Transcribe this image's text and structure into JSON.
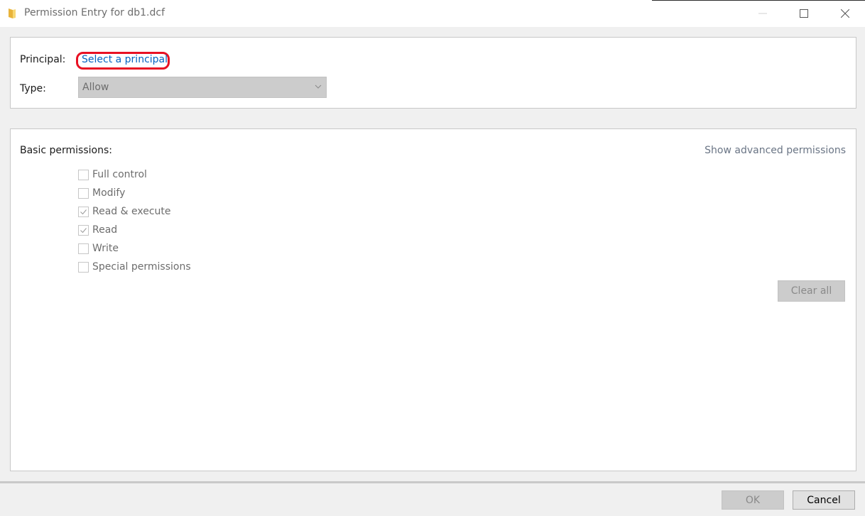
{
  "window": {
    "title": "Permission Entry for db1.dcf",
    "icon": "folder-icon",
    "controls": [
      "minimize",
      "maximize",
      "close"
    ]
  },
  "principal_section": {
    "principal_label": "Principal:",
    "principal_link": "Select a principal",
    "type_label": "Type:",
    "type_value": "Allow"
  },
  "permissions_section": {
    "heading": "Basic permissions:",
    "advanced_link": "Show advanced permissions",
    "items": [
      {
        "label": "Full control",
        "checked": false
      },
      {
        "label": "Modify",
        "checked": false
      },
      {
        "label": "Read & execute",
        "checked": true
      },
      {
        "label": "Read",
        "checked": true
      },
      {
        "label": "Write",
        "checked": false
      },
      {
        "label": "Special permissions",
        "checked": false
      }
    ],
    "clear_all_label": "Clear all"
  },
  "footer": {
    "ok_label": "OK",
    "cancel_label": "Cancel"
  },
  "colors": {
    "link": "#0563c1",
    "highlight": "#e81123",
    "disabled_text": "#6d6d6d"
  }
}
